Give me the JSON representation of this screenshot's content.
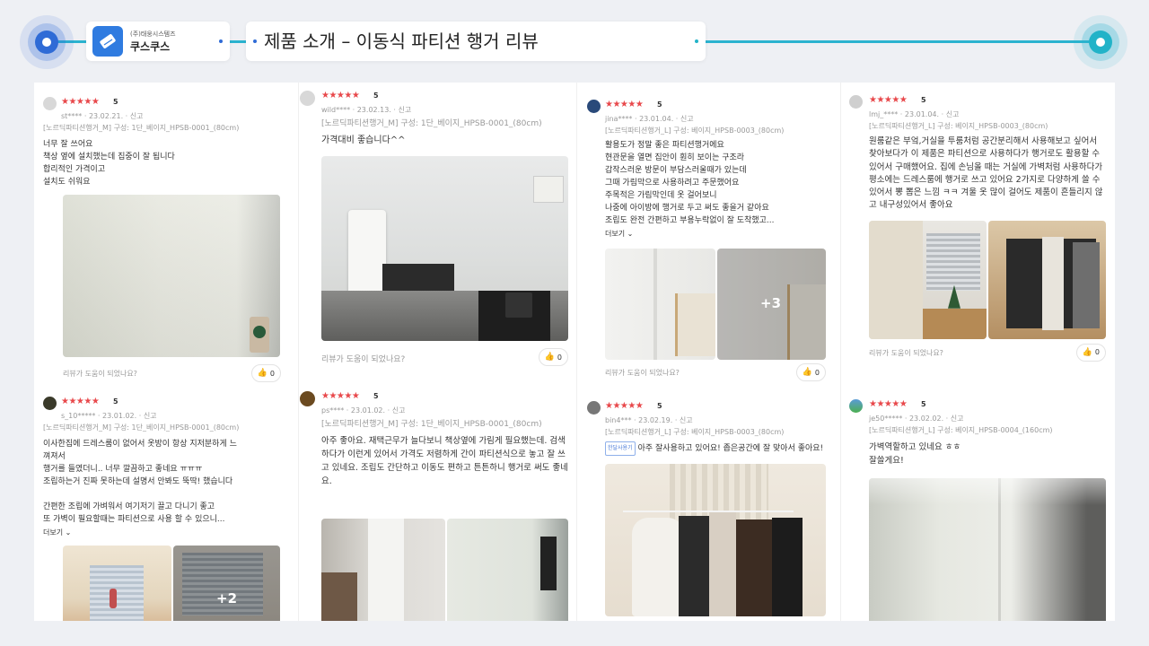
{
  "header": {
    "company_sub": "(주)태웅시스템즈",
    "company_name": "쿠스쿠스",
    "page_title": "제품 소개 – 이동식 파티션 행거 리뷰"
  },
  "colors": {
    "accent_blue": "#2f6bd6",
    "accent_cyan": "#22b3c8",
    "star_red": "#e8484b"
  },
  "common": {
    "helpful_question": "리뷰가 도움이 되었나요?",
    "more_label": "더보기",
    "report_label": "신고",
    "star_glyphs": "★★★★★"
  },
  "reviews": [
    {
      "score": "5",
      "user": "st****",
      "date": "23.02.21.",
      "option": "[노르딕파티션행거_M] 구성: 1단_베이지_HPSB-0001_(80cm)",
      "lines": [
        "너무 잘 쓰어요",
        "책상 옆에 설치했는데 집중이 잘 됩니다",
        "합리적인 가격이고",
        "설치도 쉬워요"
      ],
      "likes": "0"
    },
    {
      "score": "5",
      "user": "s_10*****",
      "date": "23.01.02.",
      "option": "[노르딕파티션행거_M] 구성: 1단_베이지_HPSB-0001_(80cm)",
      "lines": [
        "이사한집에 드레스룸이 없어서 옷방이 항상 지저분하게 느",
        "껴져서",
        "행거를 들였더니.. 너무 깔끔하고 좋네요 ㅠㅠㅠ",
        "조립하는거 진짜 못하는데 설명서 안봐도 뚝딱! 했습니다",
        "",
        "간편한 조립에 가벼워서 여기저기 끌고 다니기 좋고",
        "또 가벽이 필요할때는 파티션으로 사용 할 수 있으니..."
      ],
      "more": "더보기",
      "extra_photos": "+2"
    },
    {
      "score": "5",
      "user": "wild****",
      "date": "23.02.13.",
      "option": "[노르딕파티션행거_M] 구성: 1단_베이지_HPSB-0001_(80cm)",
      "lines": [
        "가격대비 좋습니다^^"
      ],
      "likes": "0"
    },
    {
      "score": "5",
      "user": "ps****",
      "date": "23.01.02.",
      "option": "[노르딕파티션행거_M] 구성: 1단_베이지_HPSB-0001_(80cm)",
      "text": "아주 좋아요. 재택근무가 늘다보니 책상옆에 가림게 필요했는데. 검색하다가 이런게 있어서 가격도 저렴하게 간이 파티션식으로 놓고 잘 쓰고 있네요. 조립도 간단하고 이동도 편하고 튼튼하니 행거로 써도 좋네요."
    },
    {
      "score": "5",
      "user": "jina****",
      "date": "23.01.04.",
      "option": "[노르딕파티션행거_L] 구성: 베이지_HPSB-0003_(80cm)",
      "lines": [
        "활용도가 정말 좋은 파티션행거에요",
        "현관문을 열면 집안이 훤히 보이는 구조라",
        "갑작스러운 방문이 부담스러울때가 있는데",
        "그때 가림막으로 사용하려고 주문했어요",
        "주목적은 가림막인데 옷 걸어보니",
        "나중에 아이방에 행거로 두고 써도 좋을거 같아요",
        "조립도 완전 간편하고 부용누락없이 잘 도착했고..."
      ],
      "more": "더보기",
      "extra_photos": "+3",
      "likes": "0"
    },
    {
      "score": "5",
      "user": "bin4***",
      "date": "23.02.19.",
      "option": "[노르딕파티션행거_L] 구성: 베이지_HPSB-0003_(80cm)",
      "badge": "한달사용기",
      "text": "아주 잘사용하고 있어요! 좁은공간에 잘 맞아서 좋아요!"
    },
    {
      "score": "5",
      "user": "lmj_****",
      "date": "23.01.04.",
      "option": "[노르딕파티션행거_L] 구성: 베이지_HPSB-0003_(80cm)",
      "text": "원룸같은 부엌,거실을 투룸처럼 공간분리해서 사용해보고 싶어서 찾아보다가 이 제품은 파티션으로 사용하다가 행거로도 활용할 수 있어서 구매했어요. 집에 손님올 때는 거실에 가벽처럼 사용하다가 평소에는 드레스룸에 행거로 쓰고 있어요 2가지로 다양하게 쓸 수 있어서 뽕 뽑은 느낌 ㅋㅋ 겨울 옷 많이 걸어도 제품이 흔들리지 않고 내구성있어서 좋아요",
      "likes": "0"
    },
    {
      "score": "5",
      "user": "je50*****",
      "date": "23.02.02.",
      "option": "[노르딕파티션행거_L] 구성: 베이지_HPSB-0004_(160cm)",
      "lines": [
        "가벽역할하고 있네요 ㅎㅎ",
        "잘쓸게요!"
      ]
    }
  ]
}
